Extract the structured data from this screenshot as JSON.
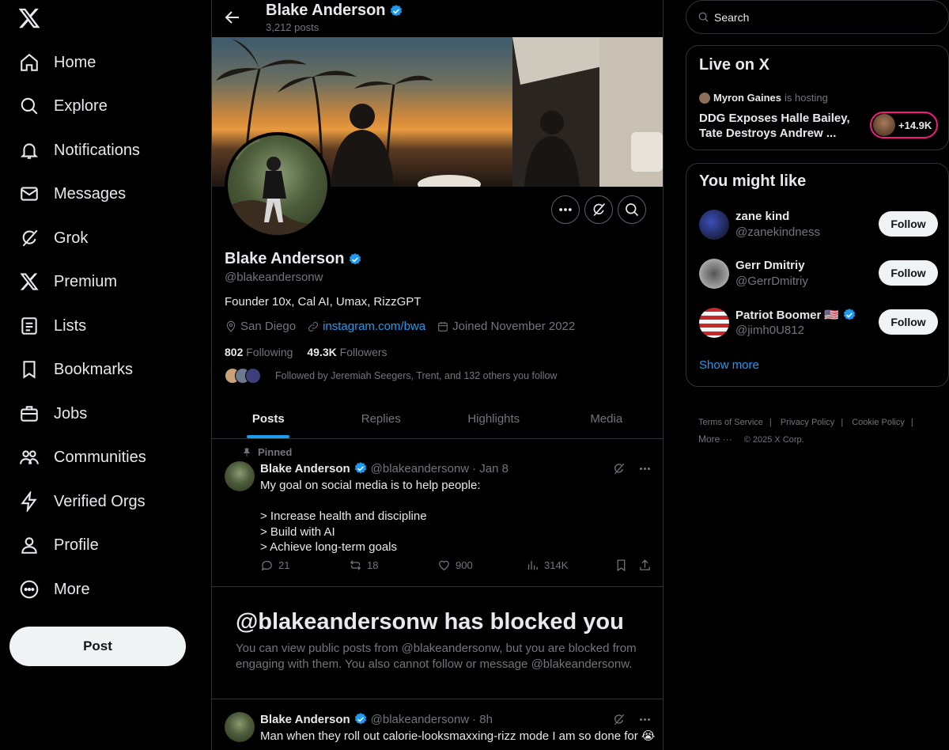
{
  "nav": {
    "items": [
      {
        "label": "Home",
        "icon": "home-icon"
      },
      {
        "label": "Explore",
        "icon": "search-icon"
      },
      {
        "label": "Notifications",
        "icon": "bell-icon"
      },
      {
        "label": "Messages",
        "icon": "envelope-icon"
      },
      {
        "label": "Grok",
        "icon": "grok-icon"
      },
      {
        "label": "Premium",
        "icon": "x-logo-icon"
      },
      {
        "label": "Lists",
        "icon": "list-icon"
      },
      {
        "label": "Bookmarks",
        "icon": "bookmark-icon"
      },
      {
        "label": "Jobs",
        "icon": "briefcase-icon"
      },
      {
        "label": "Communities",
        "icon": "people-icon"
      },
      {
        "label": "Verified Orgs",
        "icon": "lightning-icon"
      },
      {
        "label": "Profile",
        "icon": "person-icon"
      },
      {
        "label": "More",
        "icon": "more-circle-icon"
      }
    ],
    "post_label": "Post"
  },
  "header": {
    "name": "Blake Anderson",
    "posts_count": "3,212 posts"
  },
  "profile": {
    "name": "Blake Anderson",
    "handle": "@blakeandersonw",
    "bio": "Founder 10x, Cal AI, Umax, RizzGPT",
    "location": "San Diego",
    "link": "instagram.com/bwa",
    "joined": "Joined November 2022",
    "following_count": "802",
    "following_label": "Following",
    "followers_count": "49.3K",
    "followers_label": "Followers",
    "followed_by": "Followed by Jeremiah Seegers, Trent, and 132 others you follow"
  },
  "tabs": [
    "Posts",
    "Replies",
    "Highlights",
    "Media"
  ],
  "pinned_tweet": {
    "pinned_label": "Pinned",
    "name": "Blake Anderson",
    "handle": "@blakeandersonw",
    "date": "· Jan 8",
    "text": "My goal on social media is to help people:\n\n> Increase health and discipline\n> Build with AI\n> Achieve long-term goals",
    "replies": "21",
    "reposts": "18",
    "likes": "900",
    "views": "314K"
  },
  "blocked": {
    "title": "@blakeandersonw has blocked you",
    "text": "You can view public posts from @blakeandersonw, but you are blocked from engaging with them. You also cannot follow or message @blakeandersonw."
  },
  "second_tweet": {
    "name": "Blake Anderson",
    "handle": "@blakeandersonw",
    "date": "· 8h",
    "text": "Man when they roll out calorie-looksmaxxing-rizz mode I am so done for 😭"
  },
  "search": {
    "placeholder": "Search"
  },
  "live": {
    "title": "Live on X",
    "host_name": "Myron Gaines",
    "host_suffix": "is hosting",
    "stream_title": "DDG Exposes Halle Bailey, Tate Destroys Andrew ...",
    "listeners": "+14.9K"
  },
  "suggestions": {
    "title": "You might like",
    "users": [
      {
        "name": "zane kind",
        "handle": "@zanekindness",
        "verified": false,
        "flag": ""
      },
      {
        "name": "Gerr Dmitriy",
        "handle": "@GerrDmitriy",
        "verified": false,
        "flag": ""
      },
      {
        "name": "Patriot Boomer",
        "handle": "@jimh0U812",
        "verified": true,
        "flag": "🇺🇸"
      }
    ],
    "follow_label": "Follow",
    "show_more": "Show more"
  },
  "footer": {
    "links": [
      "Terms of Service",
      "Privacy Policy",
      "Cookie Policy"
    ],
    "more": "More ···",
    "copyright": "© 2025 X Corp."
  },
  "colors": {
    "accent": "#1d9bf0",
    "live": "#f91880",
    "background": "#000000"
  }
}
